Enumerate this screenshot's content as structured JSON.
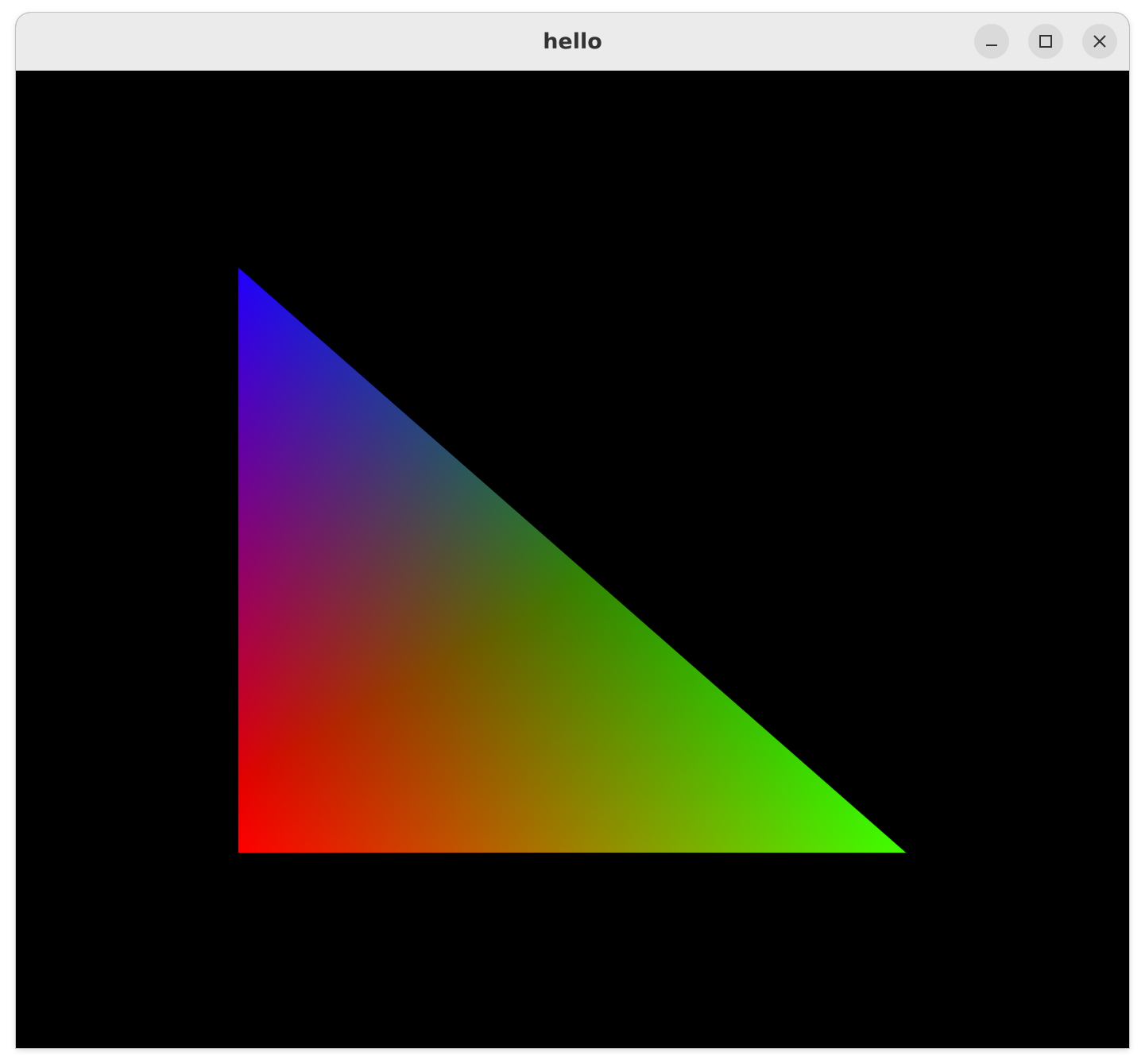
{
  "window": {
    "title": "hello",
    "controls": {
      "minimize_icon": "minimize-icon",
      "maximize_icon": "maximize-icon",
      "close_icon": "close-icon"
    }
  },
  "canvas": {
    "background": "#000000",
    "shape": "triangle",
    "vertex_colors": {
      "top_left": "#0000ff",
      "bottom_left": "#ff0000",
      "bottom_right": "#00ff00"
    }
  }
}
